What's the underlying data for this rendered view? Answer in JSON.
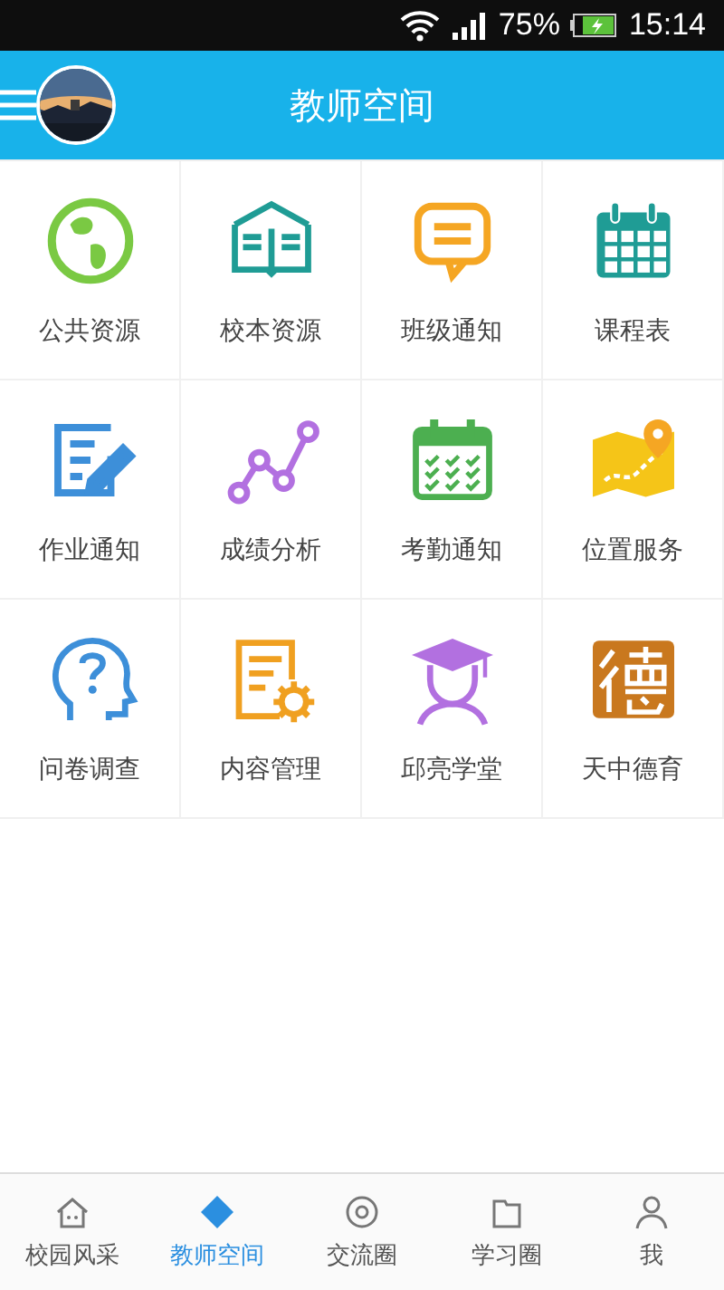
{
  "status_bar": {
    "battery": "75%",
    "time": "15:14"
  },
  "header": {
    "title": "教师空间"
  },
  "tiles": [
    {
      "label": "公共资源"
    },
    {
      "label": "校本资源"
    },
    {
      "label": "班级通知"
    },
    {
      "label": "课程表"
    },
    {
      "label": "作业通知"
    },
    {
      "label": "成绩分析"
    },
    {
      "label": "考勤通知"
    },
    {
      "label": "位置服务"
    },
    {
      "label": "问卷调查"
    },
    {
      "label": "内容管理"
    },
    {
      "label": "邱亮学堂"
    },
    {
      "label": "天中德育"
    }
  ],
  "bottom_nav": [
    {
      "label": "校园风采",
      "selected": false
    },
    {
      "label": "教师空间",
      "selected": true
    },
    {
      "label": "交流圈",
      "selected": false
    },
    {
      "label": "学习圈",
      "selected": false
    },
    {
      "label": "我",
      "selected": false
    }
  ]
}
